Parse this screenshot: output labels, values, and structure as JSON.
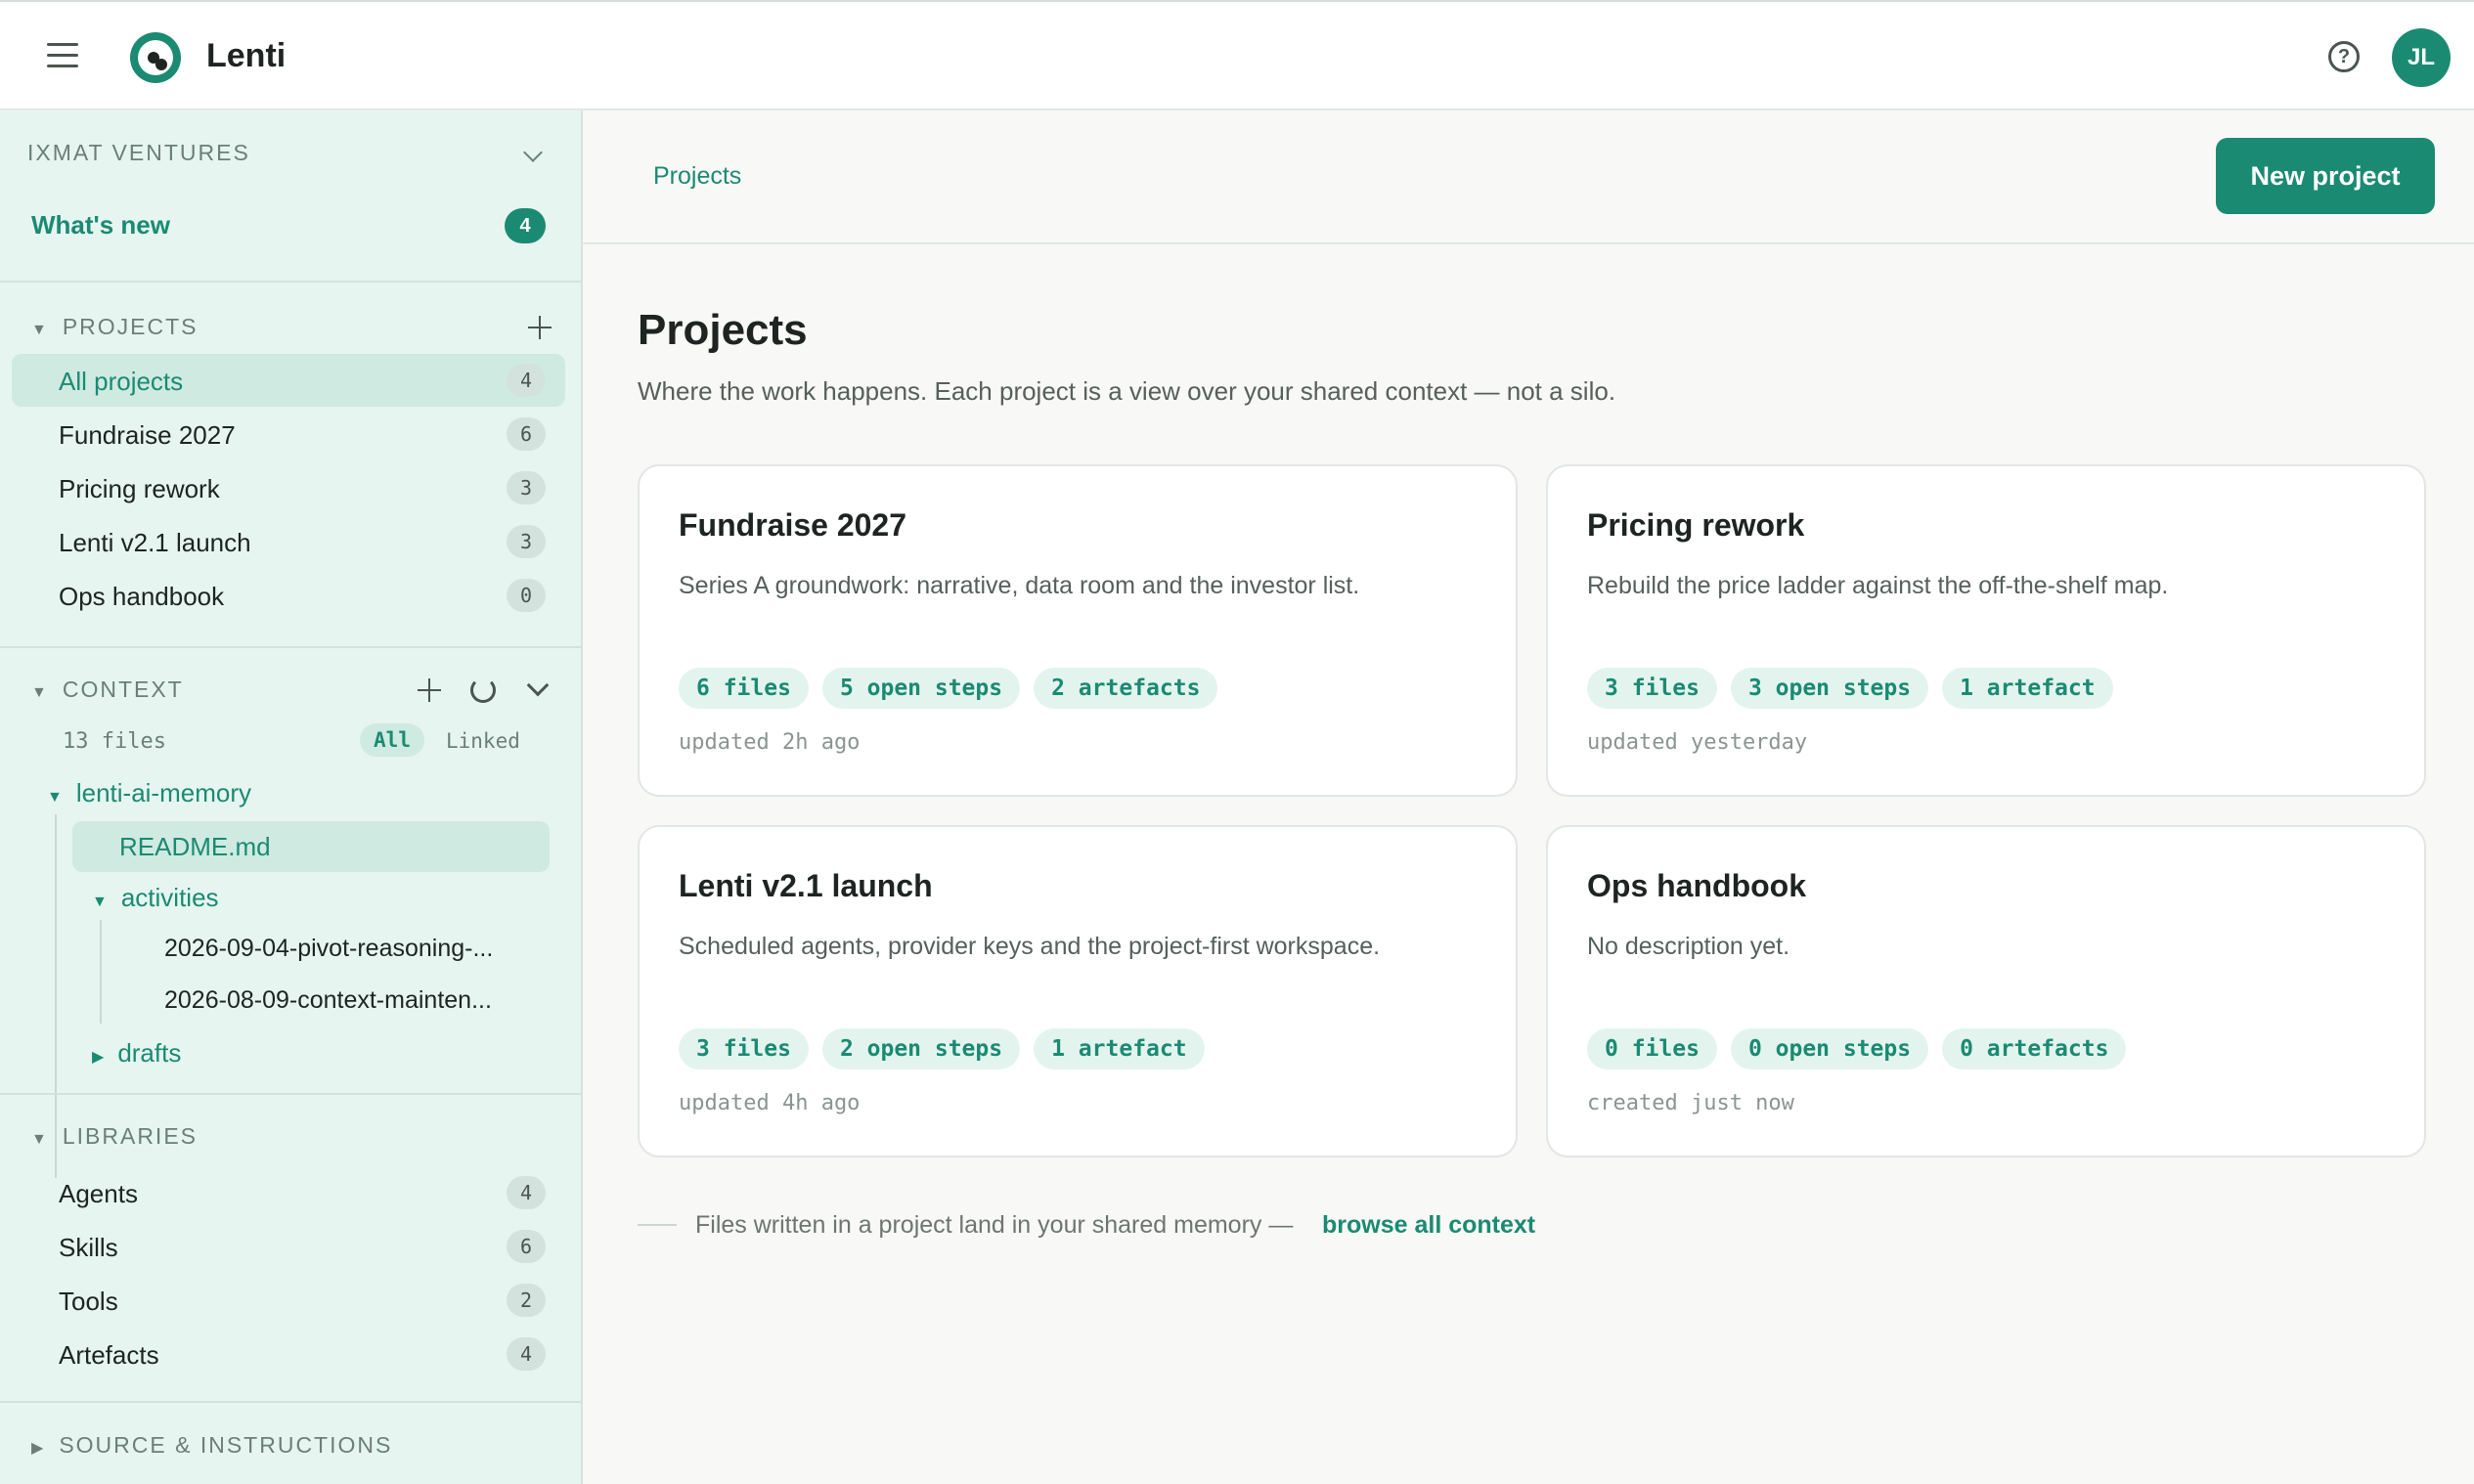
{
  "app": {
    "title": "Lenti",
    "user_initials": "JL"
  },
  "sidebar": {
    "org_name": "IXMAT VENTURES",
    "whats_new": {
      "label": "What's new",
      "count": "4"
    },
    "projects": {
      "heading": "PROJECTS",
      "items": [
        {
          "label": "All projects",
          "count": "4"
        },
        {
          "label": "Fundraise 2027",
          "count": "6"
        },
        {
          "label": "Pricing rework",
          "count": "3"
        },
        {
          "label": "Lenti v2.1 launch",
          "count": "3"
        },
        {
          "label": "Ops handbook",
          "count": "0"
        }
      ]
    },
    "context": {
      "heading": "CONTEXT",
      "file_count": "13 files",
      "filter_all": "All",
      "filter_linked": "Linked",
      "tree": {
        "root": "lenti-ai-memory",
        "readme": "README.md",
        "activities": "activities",
        "files": [
          "2026-09-04-pivot-reasoning-...",
          "2026-08-09-context-mainten..."
        ],
        "drafts": "drafts"
      }
    },
    "libraries": {
      "heading": "LIBRARIES",
      "items": [
        {
          "label": "Agents",
          "count": "4"
        },
        {
          "label": "Skills",
          "count": "6"
        },
        {
          "label": "Tools",
          "count": "2"
        },
        {
          "label": "Artefacts",
          "count": "4"
        }
      ]
    },
    "source": {
      "heading": "SOURCE & INSTRUCTIONS"
    }
  },
  "main": {
    "breadcrumb": "Projects",
    "new_project_label": "New project",
    "title": "Projects",
    "subtitle": "Where the work happens. Each project is a view over your shared context — not a silo.",
    "cards": [
      {
        "title": "Fundraise 2027",
        "desc": "Series A groundwork: narrative, data room and the investor list.",
        "tags": [
          "6 files",
          "5 open steps",
          "2 artefacts"
        ],
        "meta": "updated 2h ago"
      },
      {
        "title": "Pricing rework",
        "desc": "Rebuild the price ladder against the off-the-shelf map.",
        "tags": [
          "3 files",
          "3 open steps",
          "1 artefact"
        ],
        "meta": "updated yesterday"
      },
      {
        "title": "Lenti v2.1 launch",
        "desc": "Scheduled agents, provider keys and the project-first workspace.",
        "tags": [
          "3 files",
          "2 open steps",
          "1 artefact"
        ],
        "meta": "updated 4h ago"
      },
      {
        "title": "Ops handbook",
        "desc": "No description yet.",
        "tags": [
          "0 files",
          "0 open steps",
          "0 artefacts"
        ],
        "meta": "created just now"
      }
    ],
    "footer": {
      "text": "Files written in a project land in your shared memory —",
      "link": "browse all context"
    }
  }
}
